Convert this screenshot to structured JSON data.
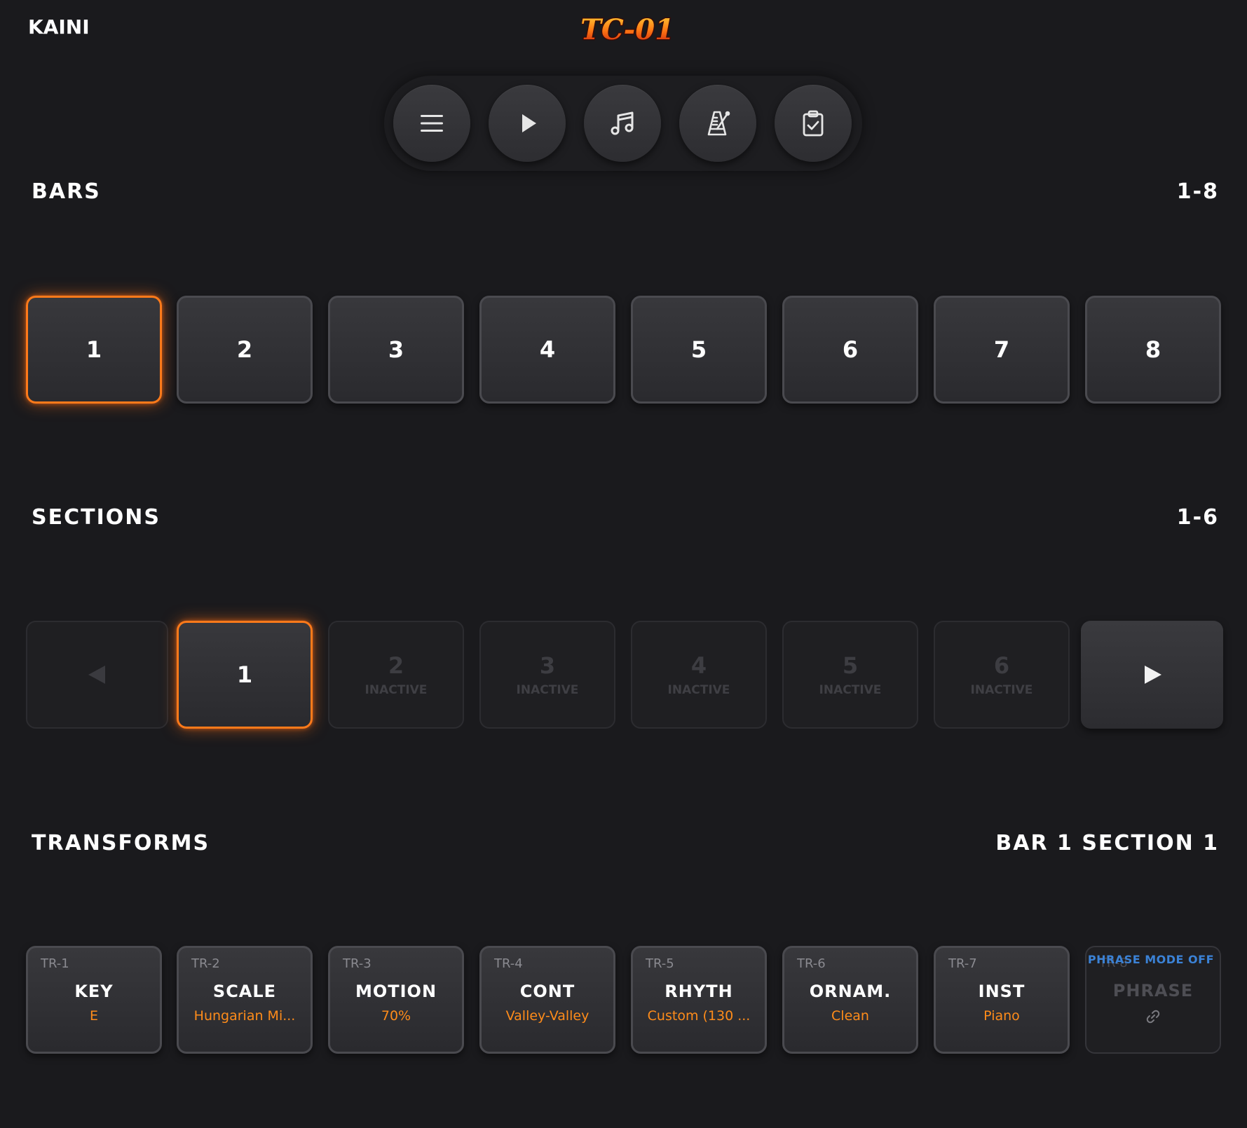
{
  "app": {
    "brand": "KAINI",
    "logo_text": "TC-01"
  },
  "toolbar": {
    "buttons": [
      {
        "icon": "menu-icon"
      },
      {
        "icon": "play-icon"
      },
      {
        "icon": "music-note-icon"
      },
      {
        "icon": "metronome-icon"
      },
      {
        "icon": "clipboard-check-icon"
      }
    ]
  },
  "bars": {
    "title": "BARS",
    "range": "1-8",
    "items": [
      "1",
      "2",
      "3",
      "4",
      "5",
      "6",
      "7",
      "8"
    ],
    "selected": "1"
  },
  "sections": {
    "title": "SECTIONS",
    "range": "1-6",
    "items": [
      {
        "label": "1",
        "state": ""
      },
      {
        "label": "2",
        "state": "INACTIVE"
      },
      {
        "label": "3",
        "state": "INACTIVE"
      },
      {
        "label": "4",
        "state": "INACTIVE"
      },
      {
        "label": "5",
        "state": "INACTIVE"
      },
      {
        "label": "6",
        "state": "INACTIVE"
      }
    ],
    "selected": "1"
  },
  "transforms": {
    "title": "TRANSFORMS",
    "context": "BAR 1 SECTION 1",
    "items": [
      {
        "id": "TR-1",
        "name": "KEY",
        "value": "E"
      },
      {
        "id": "TR-2",
        "name": "SCALE",
        "value": "Hungarian Mi..."
      },
      {
        "id": "TR-3",
        "name": "MOTION",
        "value": "70%"
      },
      {
        "id": "TR-4",
        "name": "CONT",
        "value": "Valley-Valley"
      },
      {
        "id": "TR-5",
        "name": "RHYTH",
        "value": "Custom (130 ..."
      },
      {
        "id": "TR-6",
        "name": "ORNAM.",
        "value": "Clean"
      },
      {
        "id": "TR-7",
        "name": "INST",
        "value": "Piano"
      },
      {
        "id": "TR-8",
        "name": "PHRASE",
        "note": "PHRASE MODE OFF",
        "icon": "link-icon"
      }
    ]
  },
  "colors": {
    "accent": "#ff7a1a",
    "value_text": "#ff8c1a",
    "mode_note": "#3b82d6",
    "background": "#1a1a1d"
  }
}
